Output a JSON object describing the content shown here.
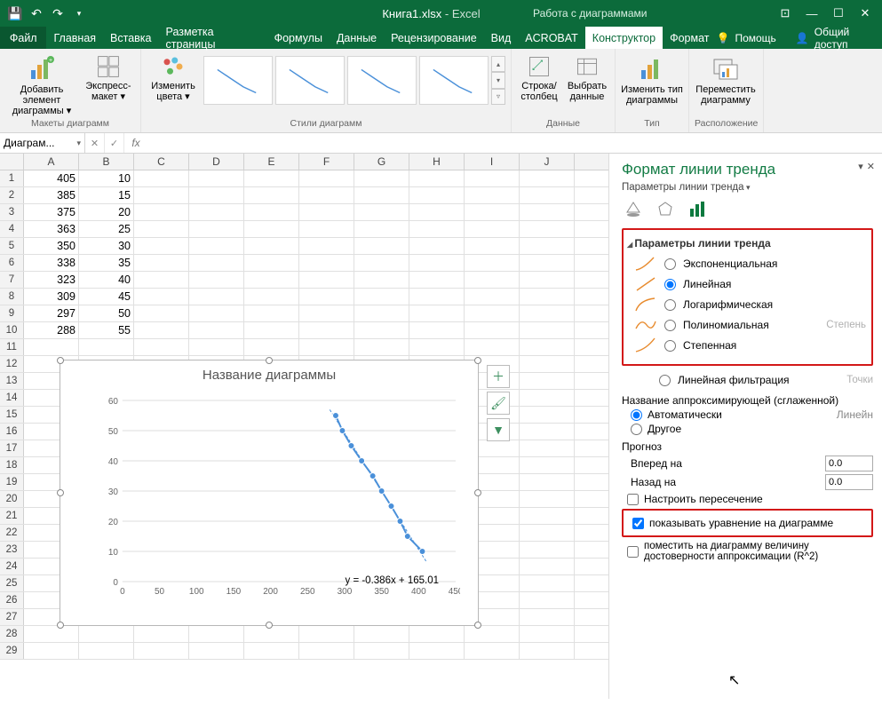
{
  "titlebar": {
    "filename": "Книга1.xlsx",
    "app": " - Excel",
    "context_label": "Работа с диаграммами"
  },
  "tabs": {
    "file": "Файл",
    "home": "Главная",
    "insert": "Вставка",
    "layout": "Разметка страницы",
    "formulas": "Формулы",
    "data": "Данные",
    "review": "Рецензирование",
    "view": "Вид",
    "acrobat": "ACROBAT",
    "constructor": "Конструктор",
    "format": "Формат",
    "help": "Помощь",
    "share": "Общий доступ"
  },
  "ribbon": {
    "add_element": "Добавить элемент диаграммы ▾",
    "express": "Экспресс-макет ▾",
    "layouts_group": "Макеты диаграмм",
    "change_colors": "Изменить цвета ▾",
    "styles_group": "Стили диаграмм",
    "switch_rowcol": "Строка/столбец",
    "select_data": "Выбрать данные",
    "data_group": "Данные",
    "change_type": "Изменить тип диаграммы",
    "type_group": "Тип",
    "move_chart": "Переместить диаграмму",
    "location_group": "Расположение"
  },
  "namebox": "Диаграм...",
  "columns": [
    "A",
    "B",
    "C",
    "D",
    "E",
    "F",
    "G",
    "H",
    "I",
    "J"
  ],
  "rows": [
    {
      "n": 1,
      "a": "405",
      "b": "10"
    },
    {
      "n": 2,
      "a": "385",
      "b": "15"
    },
    {
      "n": 3,
      "a": "375",
      "b": "20"
    },
    {
      "n": 4,
      "a": "363",
      "b": "25"
    },
    {
      "n": 5,
      "a": "350",
      "b": "30"
    },
    {
      "n": 6,
      "a": "338",
      "b": "35"
    },
    {
      "n": 7,
      "a": "323",
      "b": "40"
    },
    {
      "n": 8,
      "a": "309",
      "b": "45"
    },
    {
      "n": 9,
      "a": "297",
      "b": "50"
    },
    {
      "n": 10,
      "a": "288",
      "b": "55"
    }
  ],
  "extra_rows": [
    11,
    12,
    13,
    14,
    15,
    16,
    17,
    18,
    19,
    20,
    21,
    22,
    23,
    24,
    25,
    26,
    27,
    28,
    29
  ],
  "chart": {
    "title": "Название диаграммы",
    "equation": "y = -0.386x + 165.01"
  },
  "chart_data": {
    "type": "scatter",
    "x": [
      288,
      297,
      309,
      323,
      338,
      350,
      363,
      375,
      385,
      405
    ],
    "y": [
      55,
      50,
      45,
      40,
      35,
      30,
      25,
      20,
      15,
      10
    ],
    "xlabel": "",
    "ylabel": "",
    "xlim": [
      0,
      450
    ],
    "ylim": [
      0,
      60
    ],
    "xticks": [
      0,
      50,
      100,
      150,
      200,
      250,
      300,
      350,
      400,
      450
    ],
    "yticks": [
      0,
      10,
      20,
      30,
      40,
      50,
      60
    ],
    "trendline": {
      "type": "linear",
      "equation": "y = -0.386x + 165.01"
    }
  },
  "taskpane": {
    "title": "Формат линии тренда",
    "subtitle": "Параметры линии тренда",
    "section": "Параметры линии тренда",
    "opt_exp": "Экспоненциальная",
    "opt_lin": "Линейная",
    "opt_log": "Логарифмическая",
    "opt_poly": "Полиномиальная",
    "poly_deg": "Степень",
    "opt_pow": "Степенная",
    "opt_mavg": "Линейная фильтрация",
    "mavg_pts": "Точки",
    "approx_label": "Название аппроксимирующей (сглаженной)",
    "auto": "Автоматически",
    "auto_val": "Линейн",
    "other": "Другое",
    "forecast": "Прогноз",
    "fwd": "Вперед на",
    "bwd": "Назад на",
    "fwd_val": "0.0",
    "bwd_val": "0.0",
    "set_intercept": "Настроить пересечение",
    "show_eq": "показывать уравнение на диаграмме",
    "show_r2": "поместить на диаграмму величину достоверности аппроксимации (R^2)"
  }
}
